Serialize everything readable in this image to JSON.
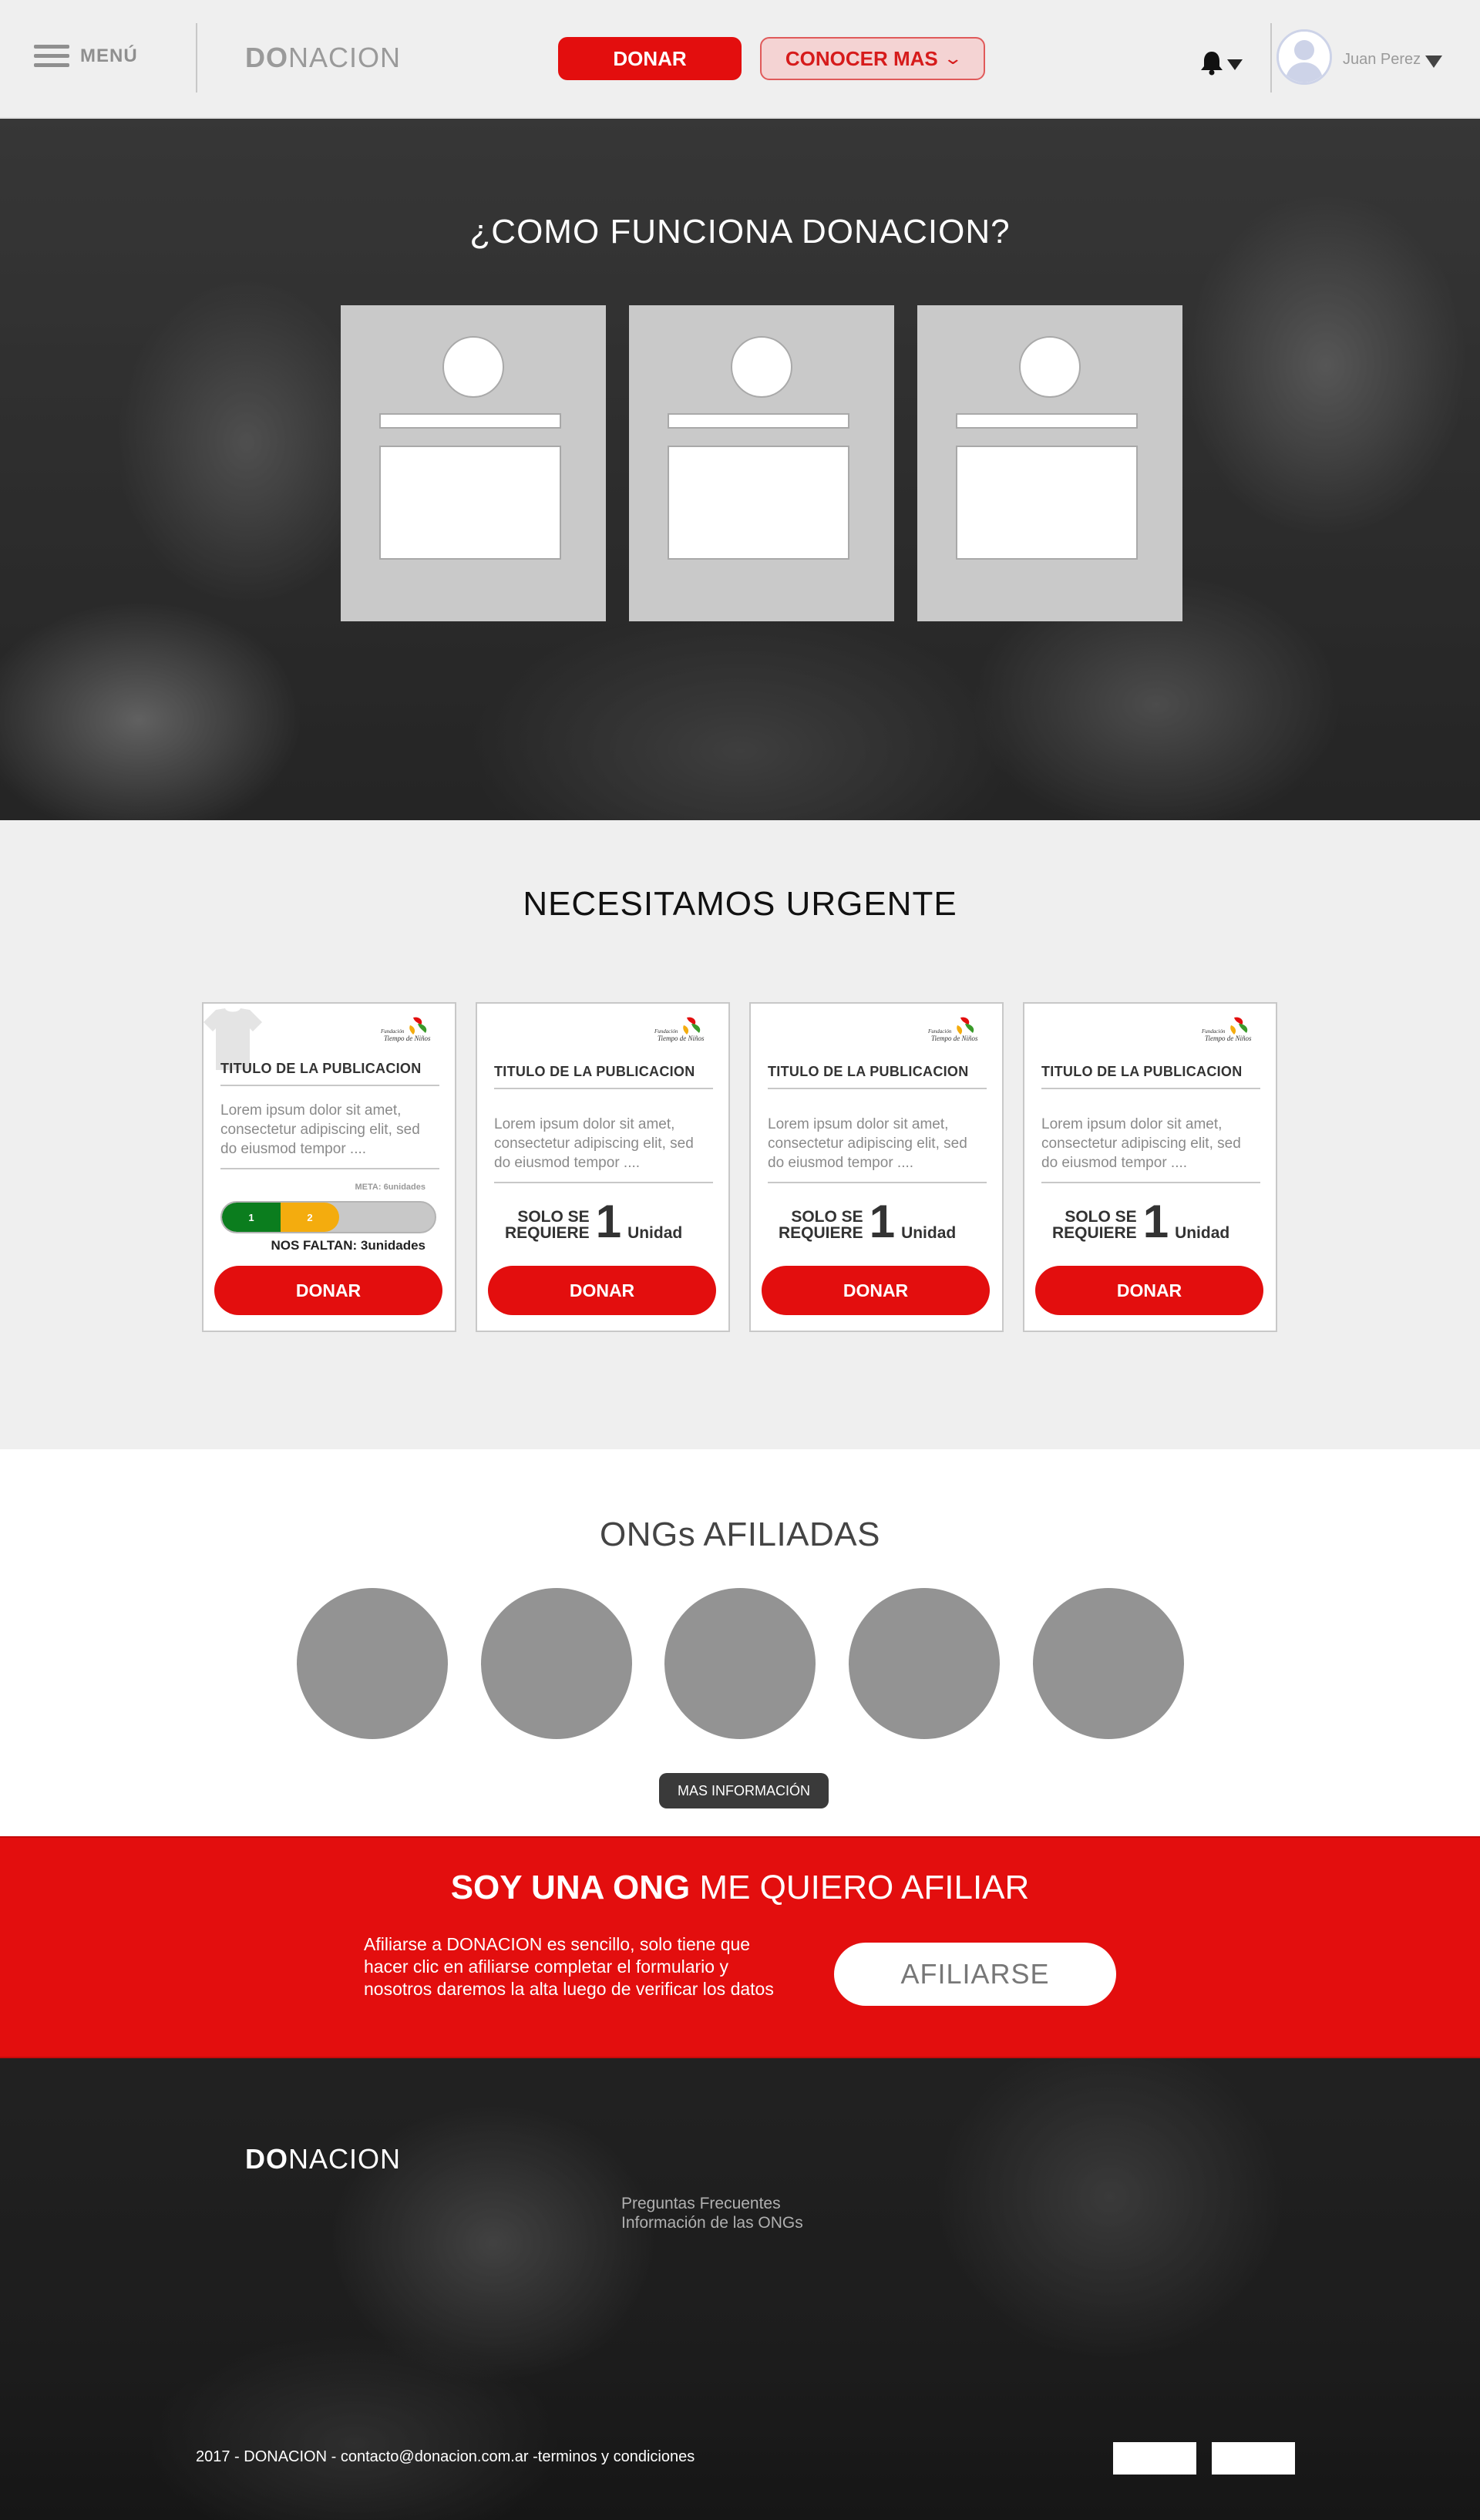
{
  "header": {
    "menu_label": "MENÚ",
    "logo_bold": "DO",
    "logo_rest": "NACION",
    "donar_label": "DONAR",
    "conocer_label": "CONOCER MAS",
    "user_name": "Juan Perez"
  },
  "hero": {
    "title": "¿COMO FUNCIONA DONACION?",
    "steps": [
      {},
      {},
      {}
    ]
  },
  "urgent": {
    "title": "NECESITAMOS URGENTE",
    "cards": [
      {
        "title": "TITULO DE LA PUBLICACION",
        "desc": "Lorem ipsum dolor sit amet, consectetur adipiscing elit, sed do eiusmod tempor ....",
        "meta": "META: 6unidades",
        "progress": {
          "segment_labels": [
            "1",
            "2"
          ],
          "filled_fraction": 0.5,
          "colors": [
            "#0b7d1e",
            "#f4ac0e"
          ]
        },
        "faltan": "NOS FALTAN: 3unidades",
        "button": "DONAR"
      },
      {
        "title": "TITULO DE LA PUBLICACION",
        "desc": "Lorem ipsum dolor sit amet, consectetur adipiscing elit, sed do eiusmod tempor ....",
        "require_line1": "SOLO SE",
        "require_line2": "REQUIERE",
        "require_qty": "1",
        "require_unit": "Unidad",
        "button": "DONAR"
      },
      {
        "title": "TITULO DE LA PUBLICACION",
        "desc": "Lorem ipsum dolor sit amet, consectetur adipiscing elit, sed do eiusmod tempor ....",
        "require_line1": "SOLO SE",
        "require_line2": "REQUIERE",
        "require_qty": "1",
        "require_unit": "Unidad",
        "button": "DONAR"
      },
      {
        "title": "TITULO DE LA PUBLICACION",
        "desc": "Lorem ipsum dolor sit amet, consectetur adipiscing elit, sed do eiusmod tempor ....",
        "require_line1": "SOLO SE",
        "require_line2": "REQUIERE",
        "require_qty": "1",
        "require_unit": "Unidad",
        "button": "DONAR"
      }
    ]
  },
  "ongs": {
    "title": "ONGs AFILIADAS",
    "count": 5,
    "more_label": "MAS INFORMACIÓN"
  },
  "afiliar": {
    "title_bold": "SOY UNA ONG",
    "title_rest": " ME QUIERO AFILIAR",
    "text": "Afiliarse a DONACION es sencillo, solo tiene que hacer clic en afiliarse completar el formulario y nosotros daremos la alta luego de verificar los datos",
    "button": "AFILIARSE"
  },
  "footer": {
    "logo_bold": "DO",
    "logo_rest": "NACION",
    "links": [
      "Preguntas Frecuentes",
      "Información de las ONGs"
    ],
    "copyright": "2017 - DONACION - contacto@donacion.com.ar -terminos y condiciones"
  },
  "colors": {
    "accent_red": "#e30e0e",
    "progress_green": "#0b7d1e",
    "progress_orange": "#f4ac0e"
  },
  "icons": [
    "menu-icon",
    "chevron-down-icon",
    "bell-icon",
    "caret-down-icon",
    "user-avatar-icon",
    "shirt-icon",
    "org-logo-icon"
  ]
}
